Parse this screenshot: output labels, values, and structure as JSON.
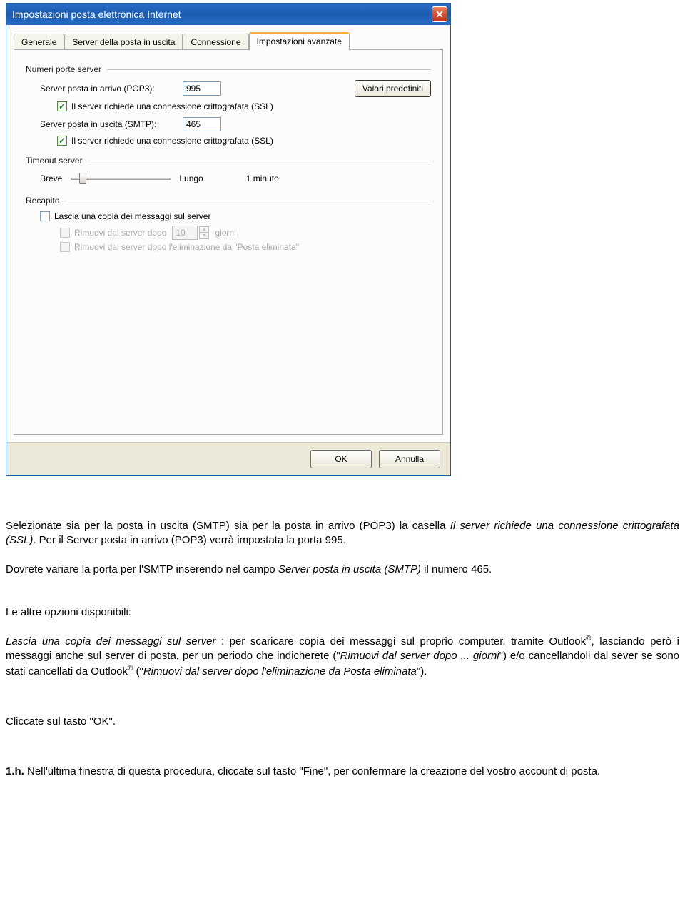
{
  "window": {
    "title": "Impostazioni posta elettronica Internet",
    "close_glyph": "✕"
  },
  "tabs": [
    {
      "label": "Generale"
    },
    {
      "label": "Server della posta in uscita"
    },
    {
      "label": "Connessione"
    },
    {
      "label": "Impostazioni avanzate"
    }
  ],
  "groups": {
    "ports": {
      "title": "Numeri porte server",
      "pop3_label": "Server posta in arrivo (POP3):",
      "pop3_value": "995",
      "defaults_btn": "Valori predefiniti",
      "ssl_pop3": "Il server richiede una connessione crittografata (SSL)",
      "smtp_label": "Server posta in uscita (SMTP):",
      "smtp_value": "465",
      "ssl_smtp": "Il server richiede una connessione crittografata (SSL)"
    },
    "timeout": {
      "title": "Timeout server",
      "short": "Breve",
      "long": "Lungo",
      "value": "1 minuto"
    },
    "delivery": {
      "title": "Recapito",
      "leave_copy": "Lascia una copia dei messaggi sul server",
      "remove_after": "Rimuovi dal server dopo",
      "remove_after_days_value": "10",
      "remove_after_days_unit": "giorni",
      "remove_deleted": "Rimuovi dal server dopo l'eliminazione da \"Posta eliminata\""
    }
  },
  "buttons": {
    "ok": "OK",
    "cancel": "Annulla"
  },
  "doc": {
    "p1a": "Selezionate sia per la posta in uscita (SMTP) sia per la posta in arrivo (POP3) la casella ",
    "p1b": "Il server richiede una connessione crittografata (SSL)",
    "p1c": ". Per il Server posta in arrivo (POP3) verrà impostata la porta 995.",
    "p2a": "Dovrete variare la porta per l'SMTP inserendo nel campo ",
    "p2b": "Server posta in uscita (SMTP)",
    "p2c": " il numero 465.",
    "p3": "Le altre opzioni disponibili:",
    "p4a": "Lascia una copia dei messaggi sul server",
    "p4b": " : per scaricare copia dei messaggi sul proprio computer, tramite Outlook",
    "p4c": ", lasciando però i messaggi anche sul server di posta, per un periodo che indicherete (\"",
    "p4d": "Rimuovi dal server dopo ... giorni",
    "p4e": "\") e/o cancellandoli dal sever se sono stati cancellati da Outlook",
    "p4f": " (\"",
    "p4g": "Rimuovi dal server dopo l'eliminazione da Posta eliminata",
    "p4h": "\").",
    "p5": "Cliccate sul tasto \"OK\".",
    "p6a": "1.h.",
    "p6b": " Nell'ultima finestra di questa procedura, cliccate sul tasto \"Fine\", per confermare la creazione del vostro account di posta.",
    "reg": "®"
  }
}
